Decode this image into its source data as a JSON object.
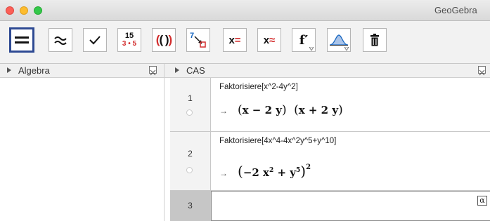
{
  "window": {
    "title": "GeoGebra"
  },
  "toolbar": {
    "tools": [
      {
        "name": "evaluate",
        "glyph": "="
      },
      {
        "name": "numeric",
        "glyph": "≈"
      },
      {
        "name": "keep-input",
        "glyph": "✓"
      },
      {
        "name": "factor",
        "top": "15",
        "bottom": "3 • 5"
      },
      {
        "name": "expand",
        "glyph": "(( ))"
      },
      {
        "name": "substitute",
        "num": "7"
      },
      {
        "name": "solve",
        "glyph": "x="
      },
      {
        "name": "solve-numerically",
        "glyph": "x≈"
      },
      {
        "name": "derivative",
        "glyph": "f′"
      },
      {
        "name": "probability-calculator"
      },
      {
        "name": "delete"
      }
    ]
  },
  "algebra": {
    "title": "Algebra"
  },
  "cas": {
    "title": "CAS",
    "rows": [
      {
        "number": "1",
        "input": "Faktorisiere[x^2-4y^2]",
        "arrow": "→"
      },
      {
        "number": "2",
        "input": "Faktorisiere[4x^4-4x^2y^5+y^10]",
        "arrow": "→"
      },
      {
        "number": "3",
        "input": ""
      }
    ],
    "alpha_label": "α"
  },
  "colors": {
    "accent": "#2e4a93",
    "red": "#d32f2f",
    "blue": "#1565c0"
  }
}
